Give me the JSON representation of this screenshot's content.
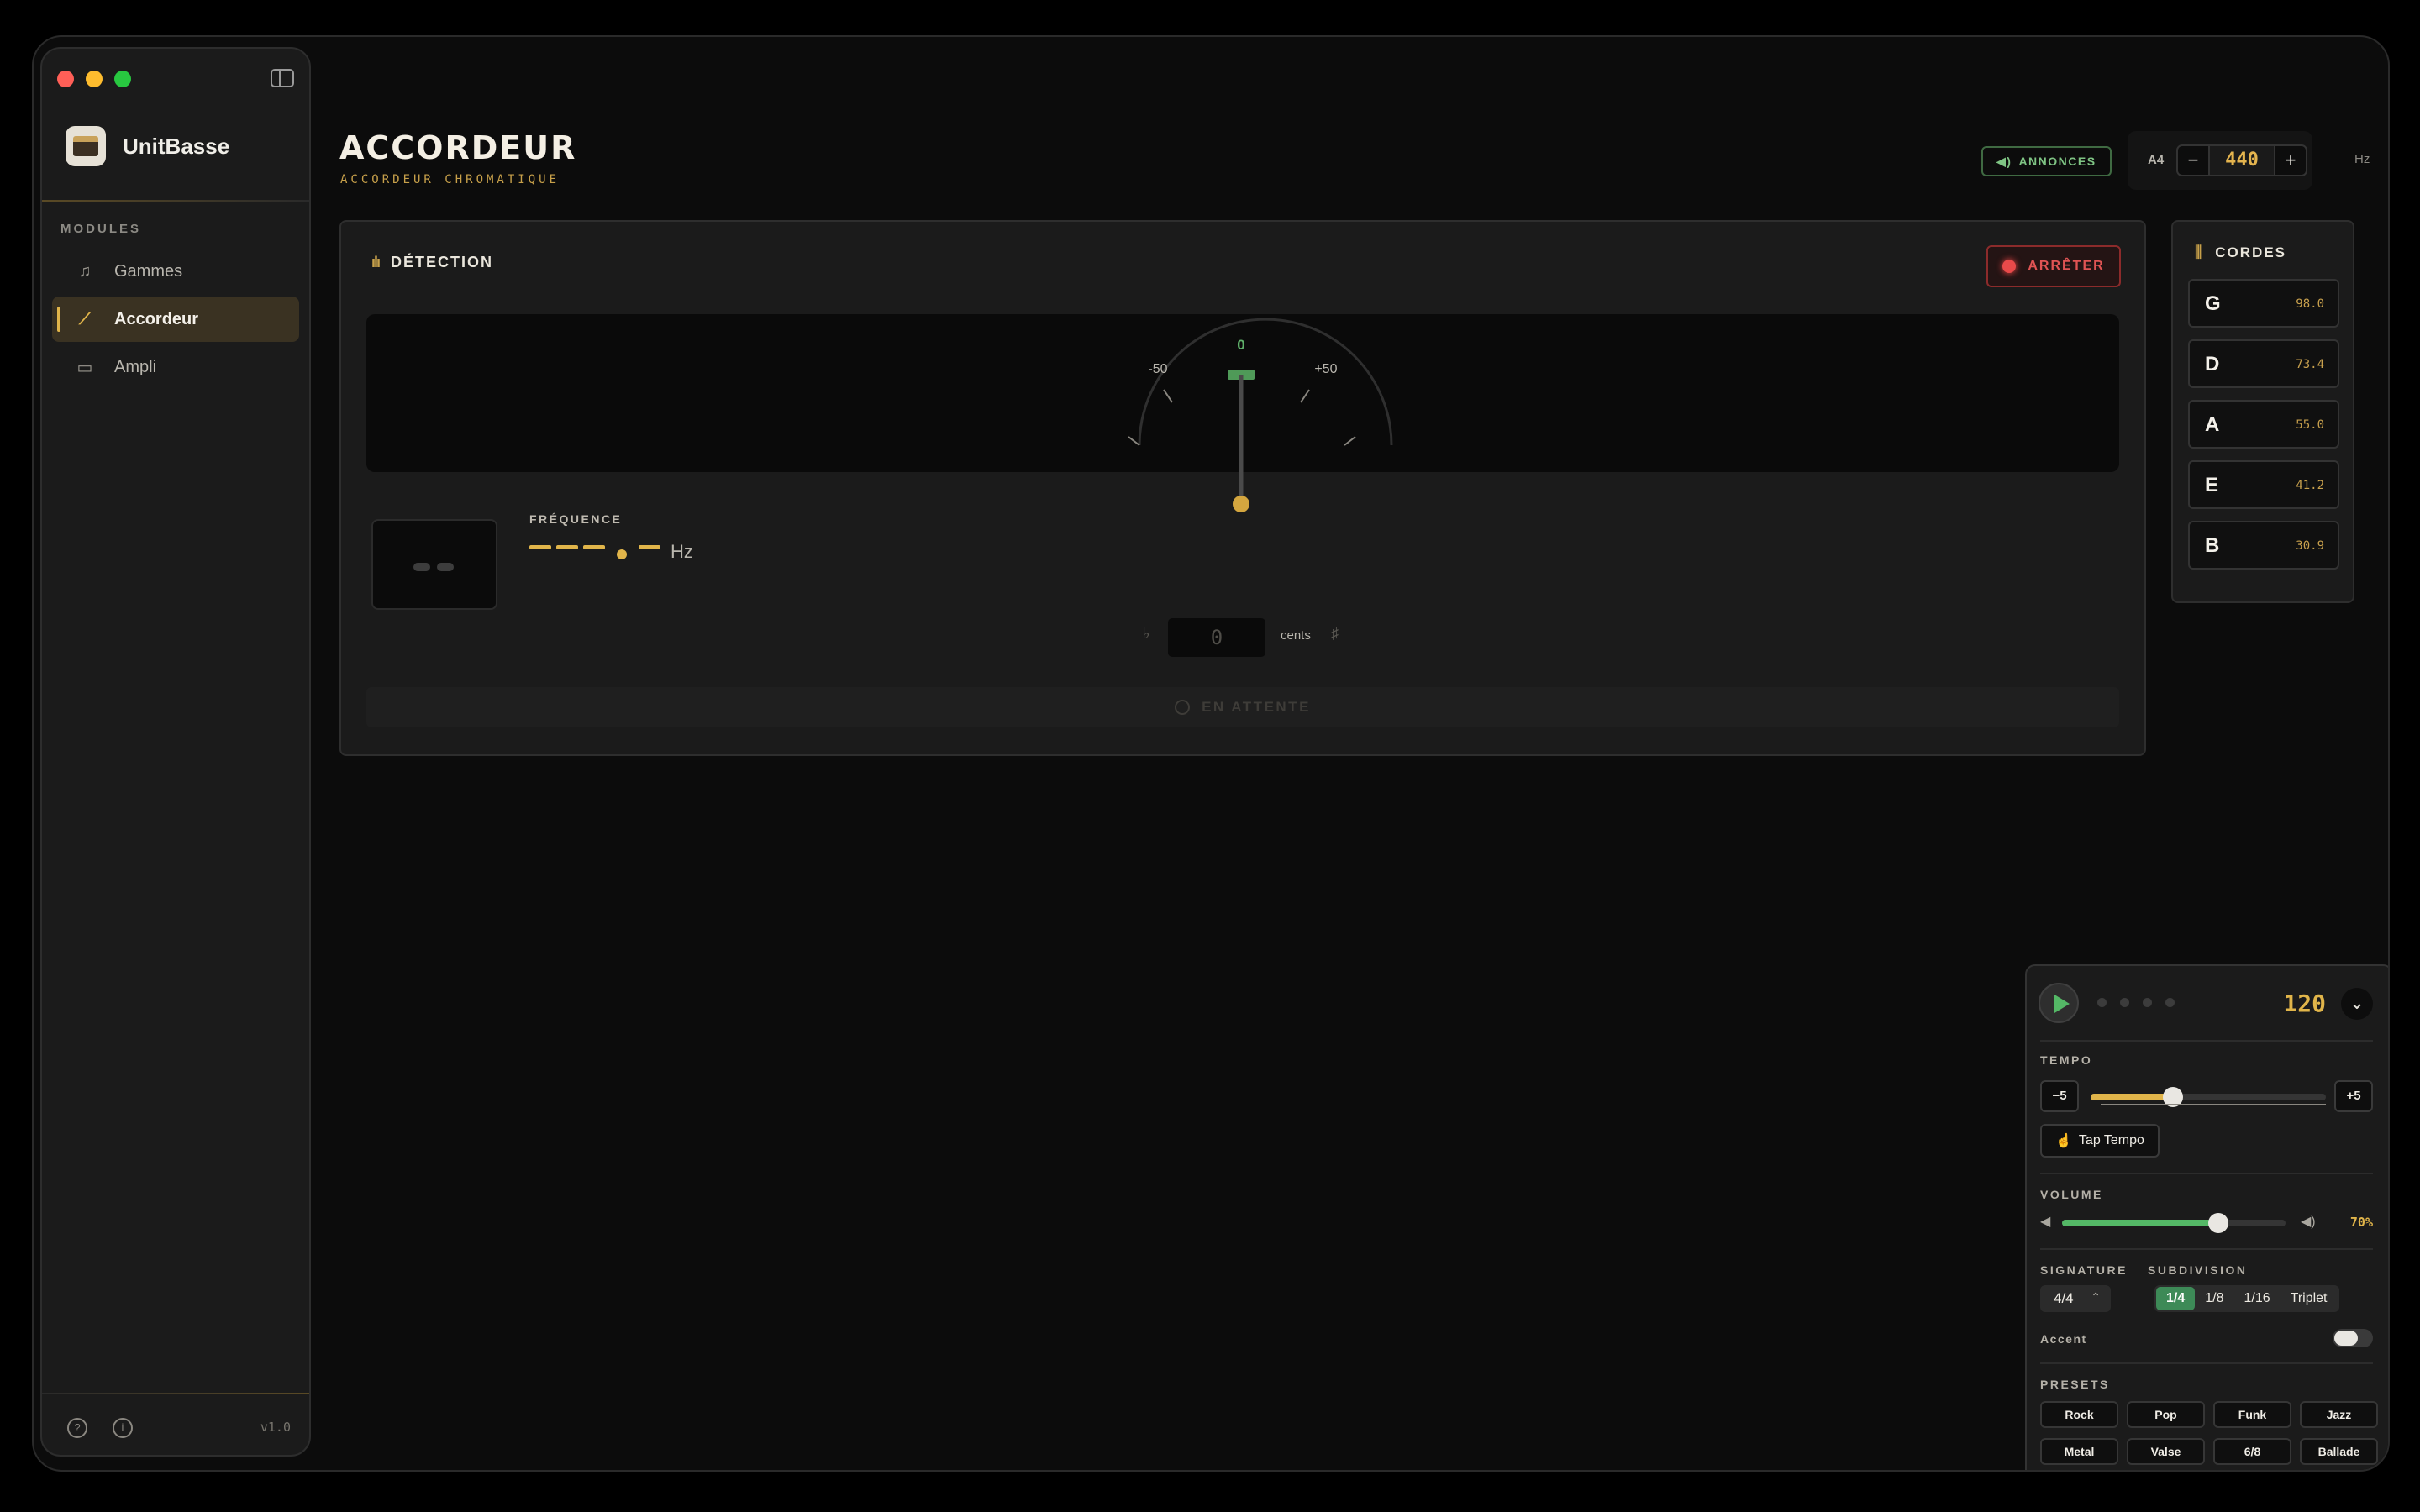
{
  "app": {
    "name": "UnitBasse",
    "version": "v1.0"
  },
  "sidebar": {
    "section_label": "MODULES",
    "items": [
      {
        "label": "Gammes",
        "icon": "music-list-icon",
        "active": false
      },
      {
        "label": "Accordeur",
        "icon": "tuning-fork-icon",
        "active": true
      },
      {
        "label": "Ampli",
        "icon": "amp-icon",
        "active": false
      }
    ]
  },
  "header": {
    "title": "ACCORDEUR",
    "subtitle": "ACCORDEUR CHROMATIQUE",
    "announce_label": "ANNONCES",
    "a4_label": "A4",
    "a4_value": "440",
    "a4_unit": "Hz"
  },
  "detection": {
    "title": "DÉTECTION",
    "stop_label": "ARRÊTER",
    "gauge": {
      "center_label": "0",
      "left_label": "-50",
      "right_label": "+50"
    },
    "frequency_label": "FRÉQUENCE",
    "frequency_unit": "Hz",
    "cents_value": "0",
    "cents_unit": "cents",
    "flat_symbol": "♭",
    "sharp_symbol": "♯",
    "status": "EN ATTENTE"
  },
  "strings": {
    "title": "CORDES",
    "items": [
      {
        "note": "G",
        "freq": "98.0"
      },
      {
        "note": "D",
        "freq": "73.4"
      },
      {
        "note": "A",
        "freq": "55.0"
      },
      {
        "note": "E",
        "freq": "41.2"
      },
      {
        "note": "B",
        "freq": "30.9"
      }
    ]
  },
  "metronome": {
    "bpm": "120",
    "tempo_label": "TEMPO",
    "tempo_minus": "−5",
    "tempo_plus": "+5",
    "tempo_level": 0.35,
    "tap_label": "Tap Tempo",
    "volume_label": "VOLUME",
    "volume_pct": "70%",
    "volume_level": 0.7,
    "signature_label": "SIGNATURE",
    "signature_value": "4/4",
    "subdivision_label": "SUBDIVISION",
    "subdivisions": [
      "1/4",
      "1/8",
      "1/16",
      "Triplet"
    ],
    "subdivision_selected": "1/4",
    "accent_label": "Accent",
    "presets_label": "PRESETS",
    "presets": [
      "Rock",
      "Pop",
      "Funk",
      "Jazz",
      "Metal",
      "Valse",
      "6/8",
      "Ballade"
    ]
  },
  "colors": {
    "accent": "#e1b54a",
    "green": "#54b866",
    "red": "#e05454"
  }
}
